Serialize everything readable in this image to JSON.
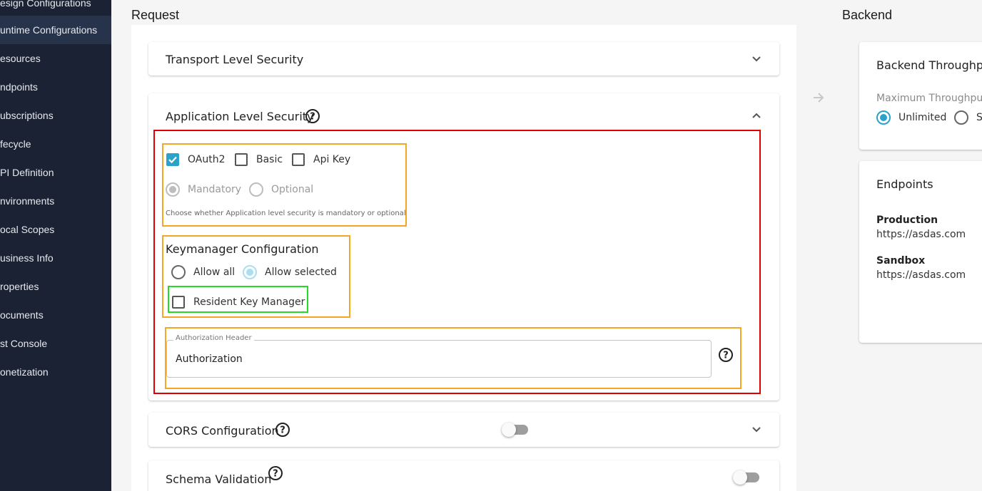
{
  "sidebar": {
    "items": [
      {
        "label": "esign Configurations"
      },
      {
        "label": "untime Configurations"
      },
      {
        "label": "esources"
      },
      {
        "label": "ndpoints"
      },
      {
        "label": "ubscriptions"
      },
      {
        "label": "fecycle"
      },
      {
        "label": "PI Definition"
      },
      {
        "label": "nvironments"
      },
      {
        "label": "ocal Scopes"
      },
      {
        "label": "usiness Info"
      },
      {
        "label": "roperties"
      },
      {
        "label": "ocuments"
      },
      {
        "label": "st Console"
      },
      {
        "label": "onetization"
      }
    ],
    "active_index": 1
  },
  "request": {
    "title": "Request",
    "transport_security": {
      "title": "Transport Level Security"
    },
    "app_security": {
      "title": "Application Level Security",
      "oauth2_label": "OAuth2",
      "oauth2_checked": true,
      "basic_label": "Basic",
      "basic_checked": false,
      "apikey_label": "Api Key",
      "apikey_checked": false,
      "mandatory_label": "Mandatory",
      "optional_label": "Optional",
      "selected_option": "Mandatory",
      "helper_text": "Choose whether Application level security is mandatory or optional",
      "keymanager": {
        "title": "Keymanager Configuration",
        "allow_all_label": "Allow all",
        "allow_selected_label": "Allow selected",
        "selected": "Allow selected",
        "resident_label": "Resident Key Manager",
        "resident_checked": false
      },
      "auth_header": {
        "label": "Authorization Header",
        "value": "Authorization"
      }
    },
    "cors": {
      "title": "CORS Configuration",
      "enabled": false
    },
    "schema_validation": {
      "title": "Schema Validation",
      "enabled": false
    }
  },
  "backend": {
    "title": "Backend",
    "throughput": {
      "title": "Backend Throughpu",
      "max_label": "Maximum Throughput",
      "unlimited_label": "Unlimited",
      "specify_label": "S",
      "selected": "Unlimited"
    },
    "endpoints": {
      "title": "Endpoints",
      "production_label": "Production",
      "production_url": "https://asdas.com",
      "sandbox_label": "Sandbox",
      "sandbox_url": "https://asdas.com"
    }
  },
  "colors": {
    "sidebar_bg": "#1a2233",
    "accent": "#29a3c9",
    "highlight_red": "#e00000",
    "highlight_orange": "#f5a623",
    "highlight_green": "#26d926"
  }
}
